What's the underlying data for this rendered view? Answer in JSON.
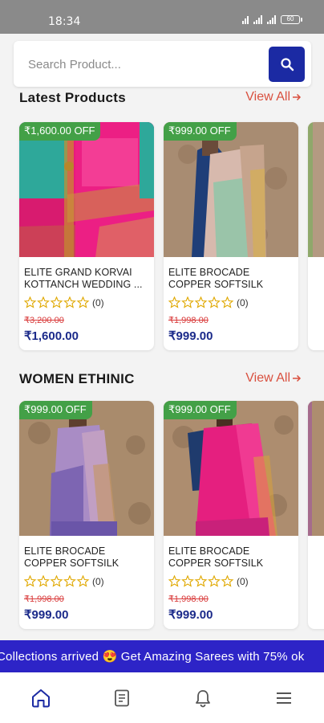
{
  "status_bar": {
    "time": "18:34",
    "battery": "60"
  },
  "search": {
    "placeholder": "Search Product..."
  },
  "sections": [
    {
      "title": "Latest Products",
      "view_all": "View All",
      "products": [
        {
          "discount": "₹1,600.00 OFF",
          "name": "ELITE GRAND KORVAI KOTTANCH WEDDING ...",
          "rating_count": "(0)",
          "old_price": "₹3,200.00",
          "price": "₹1,600.00"
        },
        {
          "discount": "₹999.00 OFF",
          "name": "ELITE BROCADE COPPER SOFTSILK SAREES",
          "rating_count": "(0)",
          "old_price": "₹1,998.00",
          "price": "₹999.00"
        }
      ]
    },
    {
      "title": "WOMEN ETHINIC",
      "view_all": "View All",
      "products": [
        {
          "discount": "₹999.00 OFF",
          "name": "ELITE BROCADE COPPER SOFTSILK SAREE",
          "rating_count": "(0)",
          "old_price": "₹1,998.00",
          "price": "₹999.00"
        },
        {
          "discount": "₹999.00 OFF",
          "name": "ELITE BROCADE COPPER SOFTSILK SAREES",
          "rating_count": "(0)",
          "old_price": "₹1,998.00",
          "price": "₹999.00"
        }
      ]
    }
  ],
  "marquee": {
    "text": "Collections arrived 😍 Get Amazing  Sarees with 75%  ok"
  },
  "bottom_nav": [
    "home-icon",
    "orders-icon",
    "bell-icon",
    "menu-icon"
  ],
  "colors": {
    "primary": "#1b2aa3",
    "accent": "#d9503f",
    "discount_badge": "#43a047",
    "price": "#1b2a8a",
    "star": "#e0a800",
    "marquee": "#2d24c7"
  }
}
